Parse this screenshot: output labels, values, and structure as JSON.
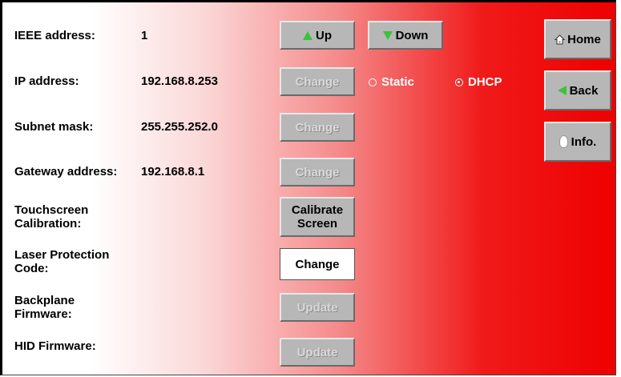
{
  "fields": [
    {
      "label": "IEEE address:",
      "value": "1"
    },
    {
      "label": "IP address:",
      "value": "192.168.8.253"
    },
    {
      "label": "Subnet mask:",
      "value": "255.255.252.0"
    },
    {
      "label": "Gateway address:",
      "value": "192.168.8.1"
    },
    {
      "label": "Touchscreen Calibration:",
      "value": ""
    },
    {
      "label": "Laser Protection Code:",
      "value": ""
    },
    {
      "label": "Backplane Firmware:",
      "value": ""
    },
    {
      "label": "HID Firmware:",
      "value": ""
    }
  ],
  "buttons": {
    "up": "Up",
    "down": "Down",
    "change_ip": "Change",
    "change_subnet": "Change",
    "change_gateway": "Change",
    "calibrate": "Calibrate Screen",
    "change_laser": "Change",
    "update_backplane": "Update",
    "update_hid": "Update",
    "home": "Home",
    "back": "Back",
    "info": "Info."
  },
  "ip_mode": {
    "static_label": "Static",
    "dhcp_label": "DHCP",
    "selected": "DHCP"
  },
  "icons": {
    "up": "arrow-up-icon",
    "down": "arrow-down-icon",
    "home": "house-icon",
    "back": "arrow-left-icon",
    "info": "lightbulb-icon"
  },
  "colors": {
    "background_gradient_end": "#ee0000",
    "button_gray": "#b7b7b7",
    "arrow_green": "#3cc23c"
  }
}
